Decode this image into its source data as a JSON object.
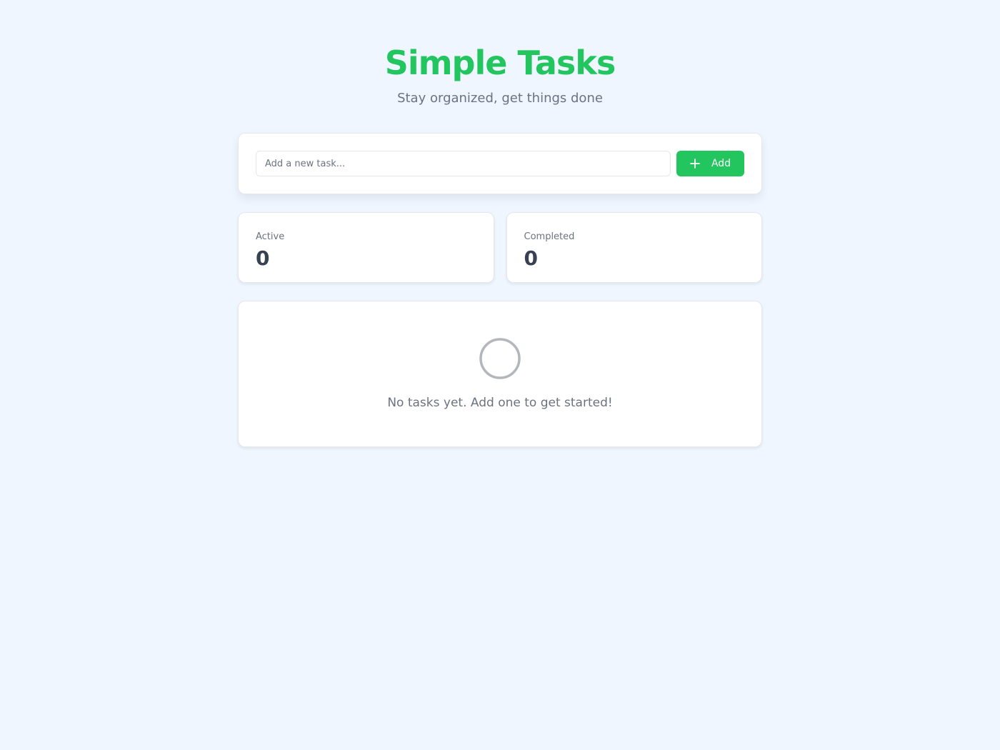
{
  "app": {
    "title": "Simple Tasks",
    "subtitle": "Stay organized, get things done"
  },
  "add_task": {
    "placeholder": "Add a new task...",
    "value": "",
    "button_label": "Add",
    "button_icon": "plus-icon"
  },
  "stats": {
    "active_label": "Active",
    "active_count": "0",
    "completed_label": "Completed",
    "completed_count": "0"
  },
  "task_list": {
    "empty_icon": "empty-circle-icon",
    "empty_message": "No tasks yet. Add one to get started!"
  },
  "colors": {
    "accent": "#22c55e",
    "background": "#eff6ff",
    "muted_text": "#6b7280"
  }
}
